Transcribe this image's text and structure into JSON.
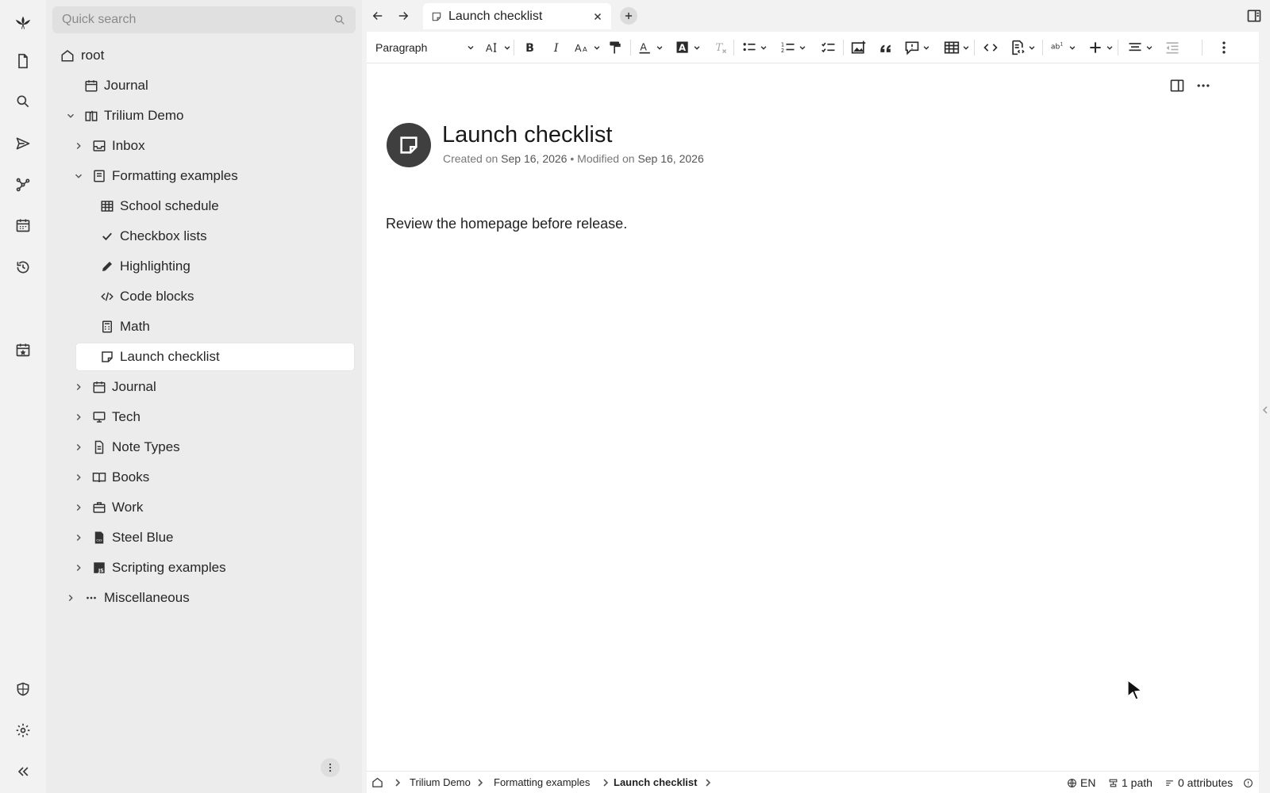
{
  "search": {
    "placeholder": "Quick search"
  },
  "launcher": {
    "items": [
      "logo-icon",
      "new-note-icon",
      "search-icon",
      "send-icon",
      "graph-icon",
      "calendar-icon",
      "history-icon",
      "today-icon",
      "shield-icon",
      "settings-icon",
      "collapse-icon"
    ]
  },
  "tree": {
    "items": [
      {
        "label": "root",
        "icon": "home-icon"
      },
      {
        "label": "Journal",
        "icon": "calendar-icon"
      },
      {
        "label": "Trilium Demo",
        "icon": "book-open-icon",
        "expanded": true
      },
      {
        "label": "Inbox",
        "icon": "inbox-icon"
      },
      {
        "label": "Formatting examples",
        "icon": "book-icon",
        "expanded": true
      },
      {
        "label": "School schedule",
        "icon": "table-icon"
      },
      {
        "label": "Checkbox lists",
        "icon": "check-icon"
      },
      {
        "label": "Highlighting",
        "icon": "pencil-icon"
      },
      {
        "label": "Code blocks",
        "icon": "code-icon"
      },
      {
        "label": "Math",
        "icon": "calculator-icon"
      },
      {
        "label": "Launch checklist",
        "icon": "sticky-note-icon",
        "active": true
      },
      {
        "label": "Journal",
        "icon": "calendar-icon"
      },
      {
        "label": "Tech",
        "icon": "monitor-icon"
      },
      {
        "label": "Note Types",
        "icon": "file-text-icon"
      },
      {
        "label": "Books",
        "icon": "book-open-icon"
      },
      {
        "label": "Work",
        "icon": "briefcase-icon"
      },
      {
        "label": "Steel Blue",
        "icon": "css-file-icon"
      },
      {
        "label": "Scripting examples",
        "icon": "js-file-icon"
      },
      {
        "label": "Miscellaneous",
        "icon": "dots-icon"
      }
    ]
  },
  "tabs": [
    {
      "label": "Launch checklist",
      "icon": "sticky-note-icon"
    }
  ],
  "toolbar": {
    "paragraph": "Paragraph",
    "buttons": [
      "text-size",
      "bold",
      "italic",
      "font-family",
      "format-painter",
      "font-color",
      "highlight",
      "remove-format",
      "bulleted-list",
      "numbered-list",
      "todo-list",
      "insert-image",
      "blockquote",
      "admonition",
      "table",
      "inline-code",
      "code-block",
      "special-characters",
      "insert",
      "alignment",
      "outdent",
      "more"
    ]
  },
  "note": {
    "title": "Launch checklist",
    "created_label": "Created on",
    "created_date": "Sep 16, 2026",
    "separator": "•",
    "modified_label": "Modified on",
    "modified_date": "Sep 16, 2026",
    "body": "Review the homepage before release."
  },
  "breadcrumb": [
    "Trilium Demo",
    "Formatting examples",
    "Launch checklist"
  ],
  "status": {
    "language": "EN",
    "paths": "1 path",
    "attributes": "0 attributes"
  },
  "colors": {
    "accent": "#3f3f3f",
    "sidebar_bg": "#ececec",
    "launcher_bg": "#f2f2f2",
    "content_bg": "#ffffff"
  }
}
